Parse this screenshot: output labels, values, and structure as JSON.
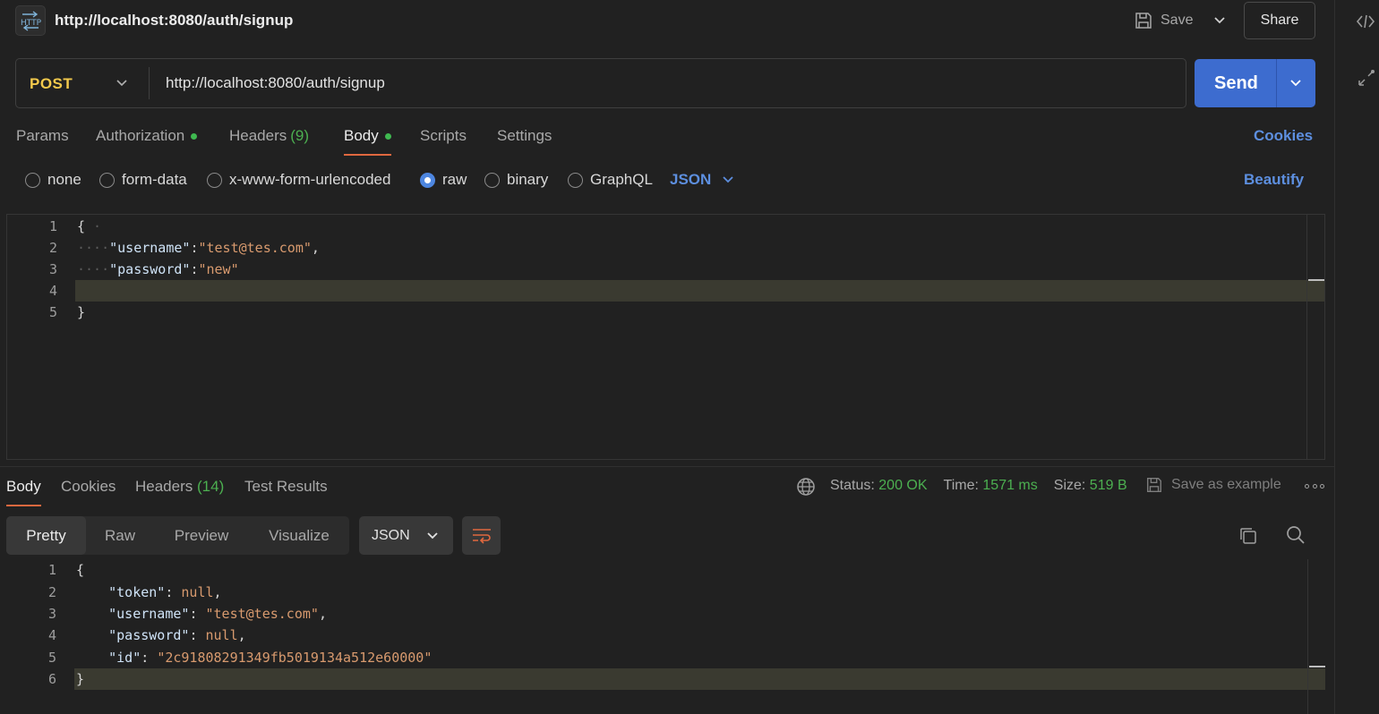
{
  "request": {
    "title": "http://localhost:8080/auth/signup",
    "badge": "HTTP",
    "save_label": "Save",
    "share_label": "Share",
    "method": "POST",
    "url": "http://localhost:8080/auth/signup",
    "send_label": "Send"
  },
  "request_tabs": {
    "params": "Params",
    "authorization": "Authorization",
    "headers": "Headers",
    "headers_count": "(9)",
    "body": "Body",
    "scripts": "Scripts",
    "settings": "Settings",
    "cookies": "Cookies"
  },
  "body_types": {
    "none": "none",
    "form_data": "form-data",
    "urlencoded": "x-www-form-urlencoded",
    "raw": "raw",
    "binary": "binary",
    "graphql": "GraphQL",
    "language": "JSON",
    "beautify": "Beautify",
    "selected": "raw"
  },
  "request_body": {
    "ln1": "1",
    "ln2": "2",
    "ln3": "3",
    "ln4": "4",
    "ln5": "5",
    "open": "{",
    "key1": "\"username\"",
    "val1": "\"test@tes.com\"",
    "key2": "\"password\"",
    "val2": "\"new\"",
    "close": "}"
  },
  "response_tabs": {
    "body": "Body",
    "cookies": "Cookies",
    "headers": "Headers",
    "headers_count": "(14)",
    "test_results": "Test Results"
  },
  "response_status": {
    "status_label": "Status:",
    "status_value": "200 OK",
    "time_label": "Time:",
    "time_value": "1571 ms",
    "size_label": "Size:",
    "size_value": "519 B",
    "save_example": "Save as example"
  },
  "response_view": {
    "pretty": "Pretty",
    "raw": "Raw",
    "preview": "Preview",
    "visualize": "Visualize",
    "format": "JSON"
  },
  "response_body": {
    "ln1": "1",
    "ln2": "2",
    "ln3": "3",
    "ln4": "4",
    "ln5": "5",
    "ln6": "6",
    "open": "{",
    "k_token": "\"token\"",
    "v_token": "null",
    "k_username": "\"username\"",
    "v_username": "\"test@tes.com\"",
    "k_password": "\"password\"",
    "v_password": "null",
    "k_id": "\"id\"",
    "v_id": "\"2c91808291349fb5019134a512e60000\"",
    "close": "}"
  },
  "colors": {
    "accent_blue": "#3d6ccf",
    "method_yellow": "#f2c94c",
    "status_green": "#4caf50",
    "tab_underline": "#e0683f"
  }
}
